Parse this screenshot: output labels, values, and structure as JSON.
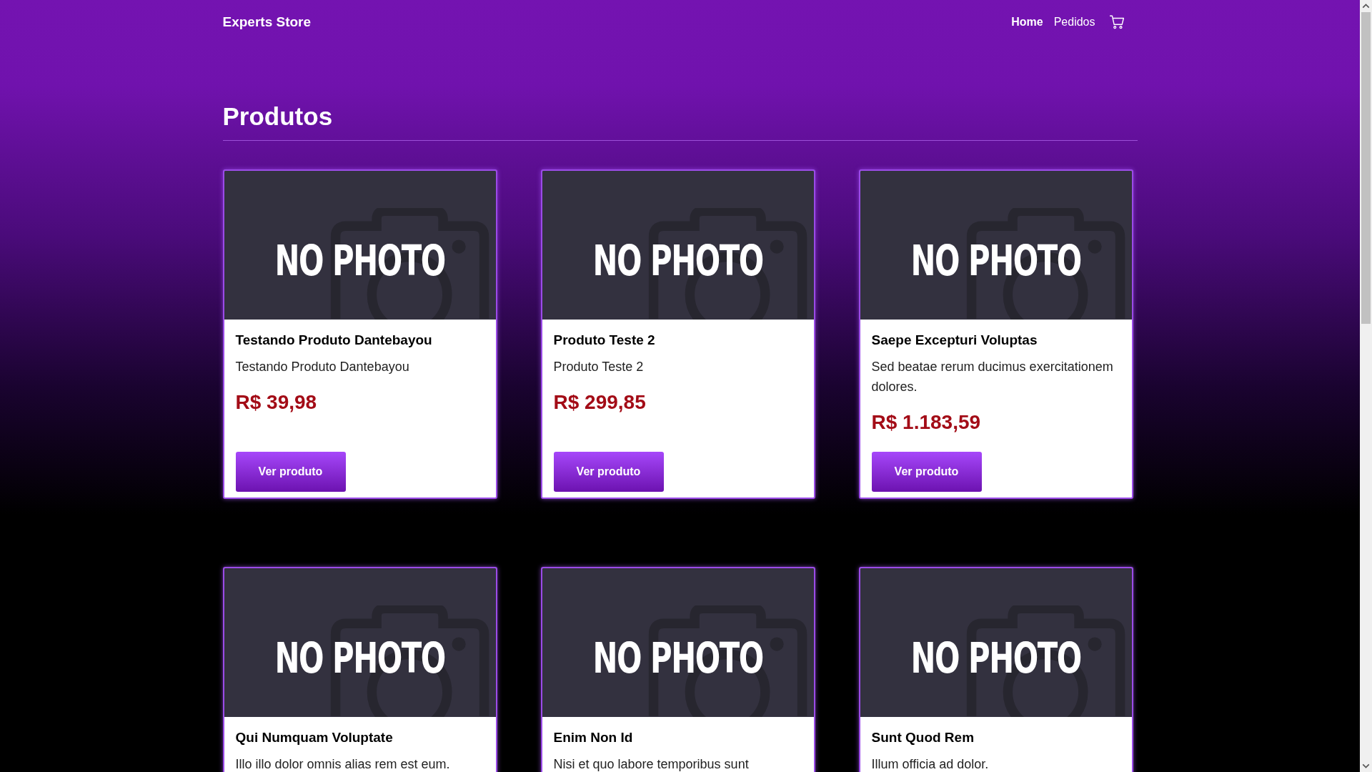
{
  "header": {
    "brand": "Experts Store",
    "nav": [
      {
        "label": "Home",
        "selected": true
      },
      {
        "label": "Pedidos",
        "selected": false
      }
    ]
  },
  "page_title": "Produtos",
  "products": [
    {
      "placeholder_text": "NO PHOTO",
      "name": "Testando Produto Dantebayou",
      "description": "Testando Produto Dantebayou",
      "price": "R$ 39,98",
      "button": "Ver produto"
    },
    {
      "placeholder_text": "NO PHOTO",
      "name": "Produto Teste 2",
      "description": "Produto Teste 2",
      "price": "R$ 299,85",
      "button": "Ver produto"
    },
    {
      "placeholder_text": "NO PHOTO",
      "name": "Saepe Excepturi Voluptas",
      "description": "Sed beatae rerum ducimus exercitationem dolores.",
      "price": "R$ 1.183,59",
      "button": "Ver produto"
    },
    {
      "placeholder_text": "NO PHOTO",
      "name": "Qui Numquam Voluptate",
      "description": "Illo illo dolor omnis alias rem est eum."
    },
    {
      "placeholder_text": "NO PHOTO",
      "name": "Enim Non Id",
      "description": "Nisi et quo labore temporibus sunt"
    },
    {
      "placeholder_text": "NO PHOTO",
      "name": "Sunt Quod Rem",
      "description": "Illum officia ad dolor."
    }
  ]
}
